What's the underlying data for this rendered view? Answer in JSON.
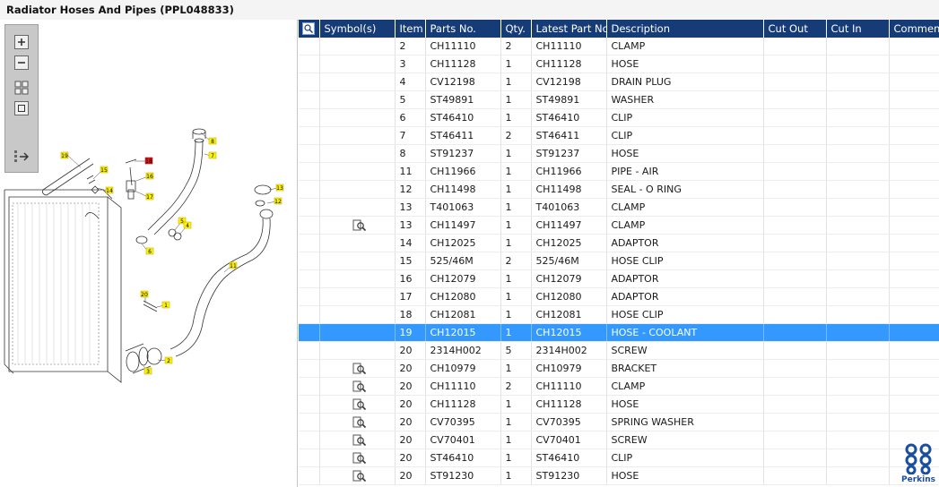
{
  "page": {
    "title": "Radiator Hoses And Pipes (PPL048833)"
  },
  "toolbar": {
    "buttons": [
      {
        "name": "zoom-in-button",
        "icon": "zoom-in-icon"
      },
      {
        "name": "zoom-out-button",
        "icon": "zoom-out-icon"
      },
      {
        "name": "fit-all-button",
        "icon": "fit-all-icon"
      },
      {
        "name": "fit-page-button",
        "icon": "fit-page-icon"
      },
      {
        "name": "export-button",
        "icon": "export-icon"
      }
    ]
  },
  "diagram": {
    "callouts": [
      "19",
      "15",
      "14",
      "16",
      "17",
      "18",
      "8",
      "7",
      "5",
      "4",
      "6",
      "13",
      "12",
      "11",
      "20",
      "1",
      "2",
      "3"
    ],
    "callout_color": "#fff200",
    "highlight_color": "#e21c1c"
  },
  "grid": {
    "header_icon": "search-icon",
    "columns": [
      "",
      "Symbol(s)",
      "Item",
      "Parts No.",
      "Qty.",
      "Latest Part No.",
      "Description",
      "Cut Out",
      "Cut In",
      "Comment"
    ],
    "selected_index": 16,
    "rows": [
      {
        "symbol": "",
        "item": "2",
        "parts_no": "CH11110",
        "qty": "2",
        "latest": "CH11110",
        "desc": "CLAMP"
      },
      {
        "symbol": "",
        "item": "3",
        "parts_no": "CH11128",
        "qty": "1",
        "latest": "CH11128",
        "desc": "HOSE"
      },
      {
        "symbol": "",
        "item": "4",
        "parts_no": "CV12198",
        "qty": "1",
        "latest": "CV12198",
        "desc": "DRAIN PLUG"
      },
      {
        "symbol": "",
        "item": "5",
        "parts_no": "ST49891",
        "qty": "1",
        "latest": "ST49891",
        "desc": "WASHER"
      },
      {
        "symbol": "",
        "item": "6",
        "parts_no": "ST46410",
        "qty": "1",
        "latest": "ST46410",
        "desc": "CLIP"
      },
      {
        "symbol": "",
        "item": "7",
        "parts_no": "ST46411",
        "qty": "2",
        "latest": "ST46411",
        "desc": "CLIP"
      },
      {
        "symbol": "",
        "item": "8",
        "parts_no": "ST91237",
        "qty": "1",
        "latest": "ST91237",
        "desc": "HOSE"
      },
      {
        "symbol": "",
        "item": "11",
        "parts_no": "CH11966",
        "qty": "1",
        "latest": "CH11966",
        "desc": "PIPE - AIR"
      },
      {
        "symbol": "",
        "item": "12",
        "parts_no": "CH11498",
        "qty": "1",
        "latest": "CH11498",
        "desc": "SEAL - O RING"
      },
      {
        "symbol": "",
        "item": "13",
        "parts_no": "T401063",
        "qty": "1",
        "latest": "T401063",
        "desc": "CLAMP"
      },
      {
        "symbol": "magnifier-icon",
        "item": "13",
        "parts_no": "CH11497",
        "qty": "1",
        "latest": "CH11497",
        "desc": "CLAMP"
      },
      {
        "symbol": "",
        "item": "14",
        "parts_no": "CH12025",
        "qty": "1",
        "latest": "CH12025",
        "desc": "ADAPTOR"
      },
      {
        "symbol": "",
        "item": "15",
        "parts_no": "525/46M",
        "qty": "2",
        "latest": "525/46M",
        "desc": "HOSE CLIP"
      },
      {
        "symbol": "",
        "item": "16",
        "parts_no": "CH12079",
        "qty": "1",
        "latest": "CH12079",
        "desc": "ADAPTOR"
      },
      {
        "symbol": "",
        "item": "17",
        "parts_no": "CH12080",
        "qty": "1",
        "latest": "CH12080",
        "desc": "ADAPTOR"
      },
      {
        "symbol": "",
        "item": "18",
        "parts_no": "CH12081",
        "qty": "1",
        "latest": "CH12081",
        "desc": "HOSE CLIP"
      },
      {
        "symbol": "",
        "item": "19",
        "parts_no": "CH12015",
        "qty": "1",
        "latest": "CH12015",
        "desc": "HOSE - COOLANT"
      },
      {
        "symbol": "",
        "item": "20",
        "parts_no": "2314H002",
        "qty": "5",
        "latest": "2314H002",
        "desc": "SCREW"
      },
      {
        "symbol": "magnifier-icon",
        "item": "20",
        "parts_no": "CH10979",
        "qty": "1",
        "latest": "CH10979",
        "desc": "BRACKET"
      },
      {
        "symbol": "magnifier-icon",
        "item": "20",
        "parts_no": "CH11110",
        "qty": "2",
        "latest": "CH11110",
        "desc": "CLAMP"
      },
      {
        "symbol": "magnifier-icon",
        "item": "20",
        "parts_no": "CH11128",
        "qty": "1",
        "latest": "CH11128",
        "desc": "HOSE"
      },
      {
        "symbol": "magnifier-icon",
        "item": "20",
        "parts_no": "CV70395",
        "qty": "1",
        "latest": "CV70395",
        "desc": "SPRING WASHER"
      },
      {
        "symbol": "magnifier-icon",
        "item": "20",
        "parts_no": "CV70401",
        "qty": "1",
        "latest": "CV70401",
        "desc": "SCREW"
      },
      {
        "symbol": "magnifier-icon",
        "item": "20",
        "parts_no": "ST46410",
        "qty": "1",
        "latest": "ST46410",
        "desc": "CLIP"
      },
      {
        "symbol": "magnifier-icon",
        "item": "20",
        "parts_no": "ST91230",
        "qty": "1",
        "latest": "ST91230",
        "desc": "HOSE"
      }
    ]
  },
  "brand": {
    "name": "Perkins",
    "color": "#1a4ea0"
  },
  "colors": {
    "header_bg": "#163c78",
    "selected_bg": "#3399ff"
  }
}
